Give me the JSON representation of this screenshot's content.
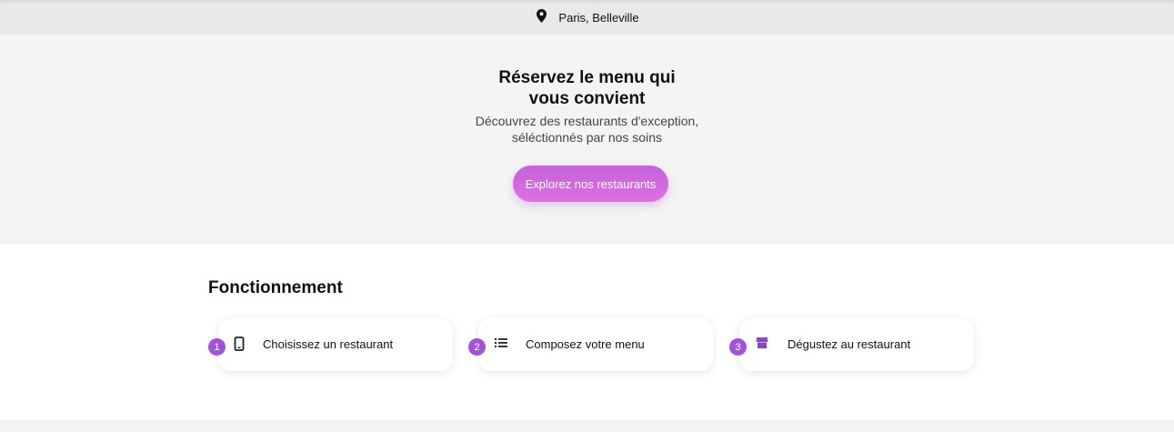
{
  "header": {
    "location": "Paris, Belleville",
    "location_icon": "map-pin-icon"
  },
  "hero": {
    "title_line1": "Réservez le menu qui",
    "title_line2": "vous convient",
    "subtitle_line1": "Découvrez des restaurants d'exception,",
    "subtitle_line2": "séléctionnés par nos soins",
    "cta_label": "Explorez nos restaurants"
  },
  "how_it_works": {
    "title": "Fonctionnement",
    "steps": [
      {
        "number": "1",
        "label": "Choisissez un restaurant",
        "icon": "smartphone-icon"
      },
      {
        "number": "2",
        "label": "Composez votre menu",
        "icon": "list-icon"
      },
      {
        "number": "3",
        "label": "Dégustez au restaurant",
        "icon": "store-icon"
      }
    ]
  },
  "colors": {
    "accent": "#a353d6",
    "cta_gradient_start": "#c463dc",
    "cta_gradient_end": "#e06ee0"
  }
}
